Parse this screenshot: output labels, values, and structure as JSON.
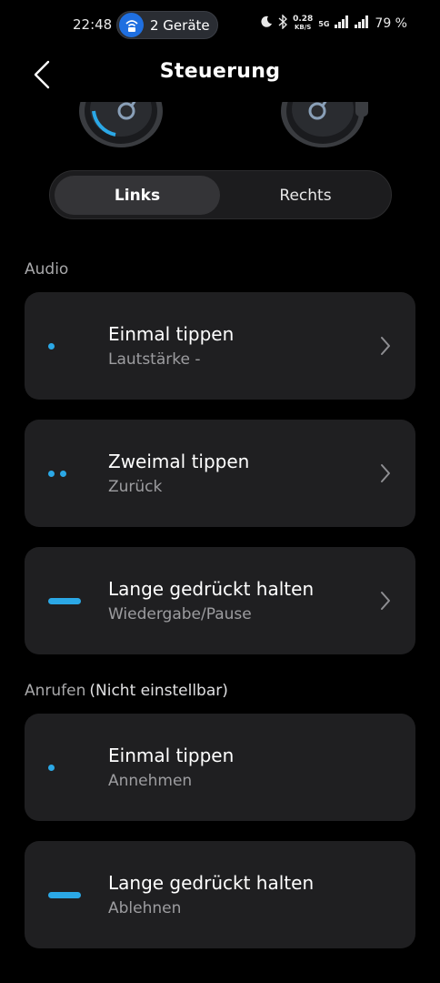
{
  "status_bar": {
    "time": "22:48",
    "devices_label": "2 Geräte",
    "speed_value": "0.28",
    "speed_unit": "KB/S",
    "network": "5G",
    "battery": "79 %"
  },
  "header": {
    "title": "Steuerung"
  },
  "segment": {
    "left_label": "Links",
    "right_label": "Rechts",
    "selected": "Links"
  },
  "audio": {
    "section_label": "Audio",
    "items": [
      {
        "title": "Einmal tippen",
        "value": "Lautstärke -",
        "indicator": "single-dot"
      },
      {
        "title": "Zweimal tippen",
        "value": "Zurück",
        "indicator": "double-dot"
      },
      {
        "title": "Lange gedrückt halten",
        "value": "Wiedergabe/Pause",
        "indicator": "long-bar"
      }
    ]
  },
  "calls": {
    "section_label": "Anrufen",
    "section_note": "(Nicht einstellbar)",
    "items": [
      {
        "title": "Einmal tippen",
        "value": "Annehmen",
        "indicator": "single-dot"
      },
      {
        "title": "Lange gedrückt halten",
        "value": "Ablehnen",
        "indicator": "long-bar"
      }
    ]
  },
  "colors": {
    "accent": "#2ba8e6",
    "card_bg": "#1f1f21",
    "background": "#000000"
  }
}
